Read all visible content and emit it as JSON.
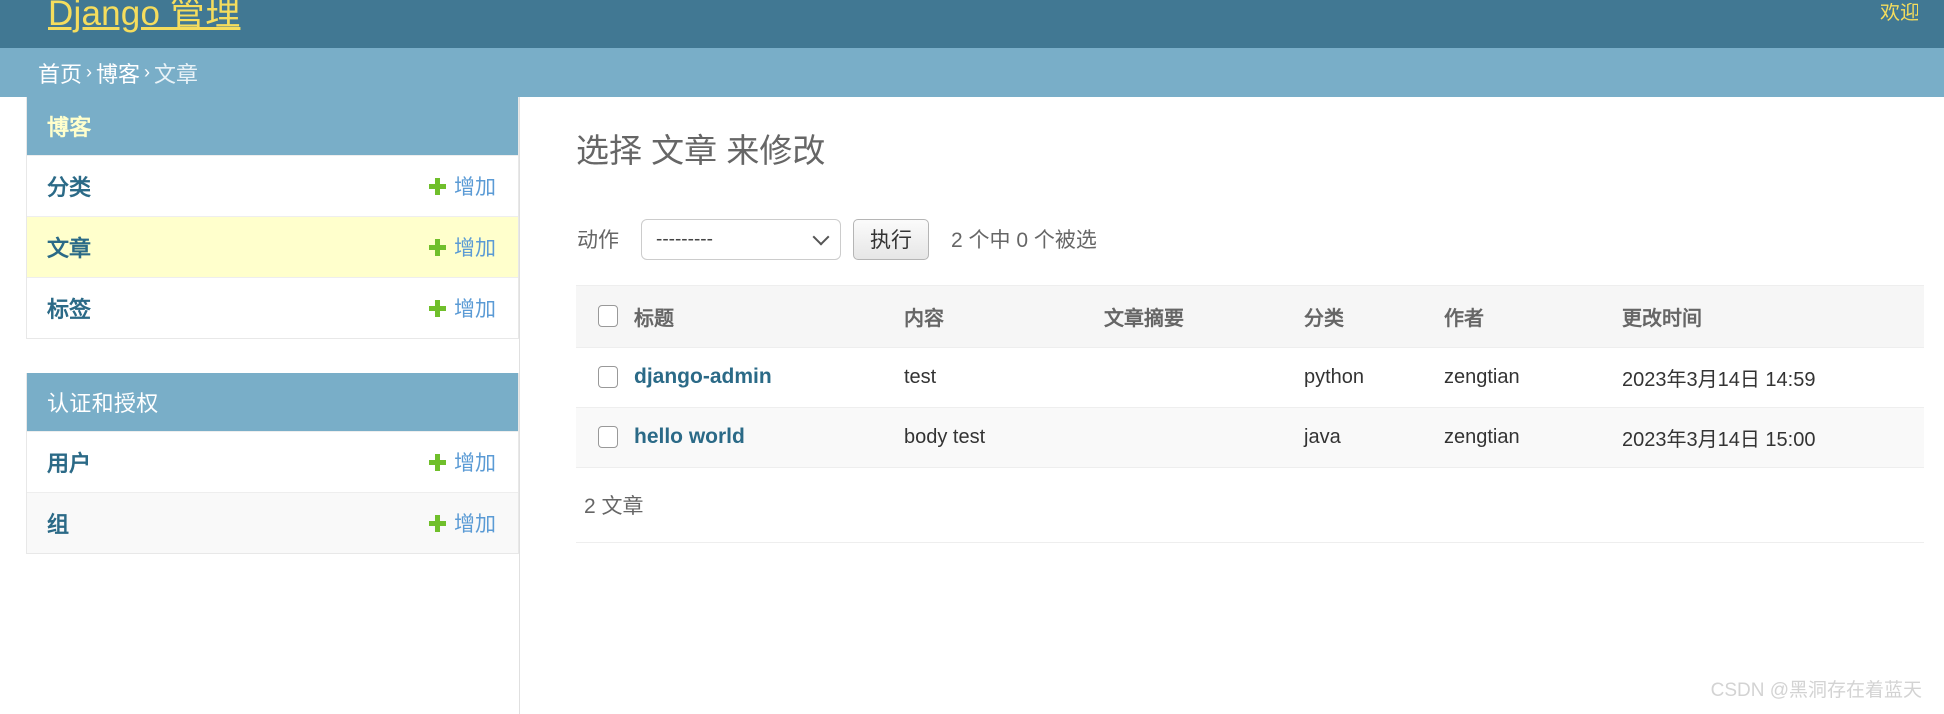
{
  "header": {
    "site_title": "Django 管理",
    "user_tools": "欢迎"
  },
  "breadcrumbs": {
    "home": "首页",
    "sep": "›",
    "app": "博客",
    "current": "文章"
  },
  "sidebar": {
    "modules": [
      {
        "caption": "博客",
        "models": [
          {
            "name": "分类",
            "add_label": "增加",
            "current": false
          },
          {
            "name": "文章",
            "add_label": "增加",
            "current": true
          },
          {
            "name": "标签",
            "add_label": "增加",
            "current": false
          }
        ]
      },
      {
        "caption": "认证和授权",
        "models": [
          {
            "name": "用户",
            "add_label": "增加",
            "current": false
          },
          {
            "name": "组",
            "add_label": "增加",
            "current": false
          }
        ]
      }
    ]
  },
  "main": {
    "title": "选择 文章 来修改",
    "actions": {
      "label": "动作",
      "selected_option": "---------",
      "options": [
        "---------"
      ],
      "go_label": "执行",
      "counter": "2 个中 0 个被选"
    },
    "table": {
      "columns": [
        "标题",
        "内容",
        "文章摘要",
        "分类",
        "作者",
        "更改时间"
      ],
      "rows": [
        {
          "title": "django-admin",
          "body": "test",
          "excerpt": "",
          "category": "python",
          "author": "zengtian",
          "modified": "2023年3月14日 14:59"
        },
        {
          "title": "hello world",
          "body": "body test",
          "excerpt": "",
          "category": "java",
          "author": "zengtian",
          "modified": "2023年3月14日 15:00"
        }
      ]
    },
    "paginator": "2 文章"
  },
  "watermark": "CSDN @黑洞存在着蓝天",
  "colors": {
    "header_bg": "#417893",
    "breadcrumb_bg": "#79aec8",
    "brand_text": "#f5dd5d",
    "link": "#2b6a87",
    "add_green": "#70bf2b",
    "current_row": "#ffffcc"
  }
}
